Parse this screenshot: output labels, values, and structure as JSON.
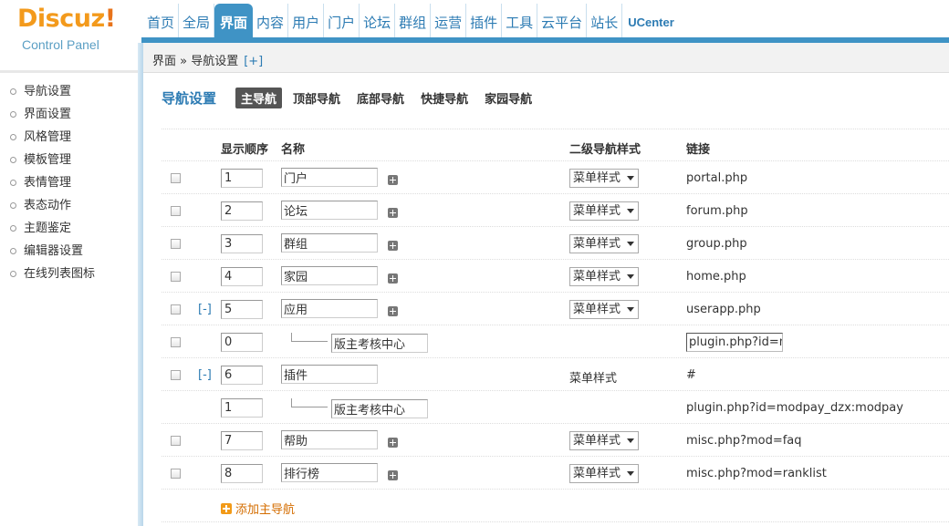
{
  "logo": {
    "brand": "Discuz",
    "bang": "!",
    "subtitle": "Control Panel"
  },
  "topnav": [
    {
      "label": "首页"
    },
    {
      "label": "全局"
    },
    {
      "label": "界面",
      "active": true
    },
    {
      "label": "内容"
    },
    {
      "label": "用户"
    },
    {
      "label": "门户"
    },
    {
      "label": "论坛"
    },
    {
      "label": "群组"
    },
    {
      "label": "运营"
    },
    {
      "label": "插件"
    },
    {
      "label": "工具"
    },
    {
      "label": "云平台"
    },
    {
      "label": "站长"
    },
    {
      "label": "UCenter"
    }
  ],
  "breadcrumb": {
    "path": "界面 » 导航设置",
    "add": "[+]"
  },
  "sidebar": {
    "items": [
      {
        "label": "导航设置"
      },
      {
        "label": "界面设置"
      },
      {
        "label": "风格管理"
      },
      {
        "label": "模板管理"
      },
      {
        "label": "表情管理"
      },
      {
        "label": "表态动作"
      },
      {
        "label": "主题鉴定"
      },
      {
        "label": "编辑器设置"
      },
      {
        "label": "在线列表图标"
      }
    ]
  },
  "subtabs": {
    "title": "导航设置",
    "tabs": [
      {
        "label": "主导航",
        "active": true
      },
      {
        "label": "顶部导航"
      },
      {
        "label": "底部导航"
      },
      {
        "label": "快捷导航"
      },
      {
        "label": "家园导航"
      }
    ]
  },
  "table": {
    "headers": {
      "order": "显示顺序",
      "name": "名称",
      "style": "二级导航样式",
      "link": "链接"
    },
    "rows": [
      {
        "order": "1",
        "name": "门户",
        "style": "菜单样式",
        "link": "portal.php"
      },
      {
        "order": "2",
        "name": "论坛",
        "style": "菜单样式",
        "link": "forum.php"
      },
      {
        "order": "3",
        "name": "群组",
        "style": "菜单样式",
        "link": "group.php"
      },
      {
        "order": "4",
        "name": "家园",
        "style": "菜单样式",
        "link": "home.php"
      },
      {
        "order": "5",
        "name": "应用",
        "style": "菜单样式",
        "link": "userapp.php",
        "toggle": "[-]"
      },
      {
        "order": "0",
        "name": "版主考核中心",
        "link": "plugin.php?id=m",
        "child": true
      },
      {
        "order": "6",
        "name": "插件",
        "style": "菜单样式",
        "link": "#",
        "toggle": "[-]"
      },
      {
        "order": "1",
        "name": "版主考核中心",
        "link": "plugin.php?id=modpay_dzx:modpay",
        "child": true
      },
      {
        "order": "7",
        "name": "帮助",
        "style": "菜单样式",
        "link": "misc.php?mod=faq"
      },
      {
        "order": "8",
        "name": "排行榜",
        "style": "菜单样式",
        "link": "misc.php?mod=ranklist"
      }
    ]
  },
  "add_main_nav": "添加主导航"
}
